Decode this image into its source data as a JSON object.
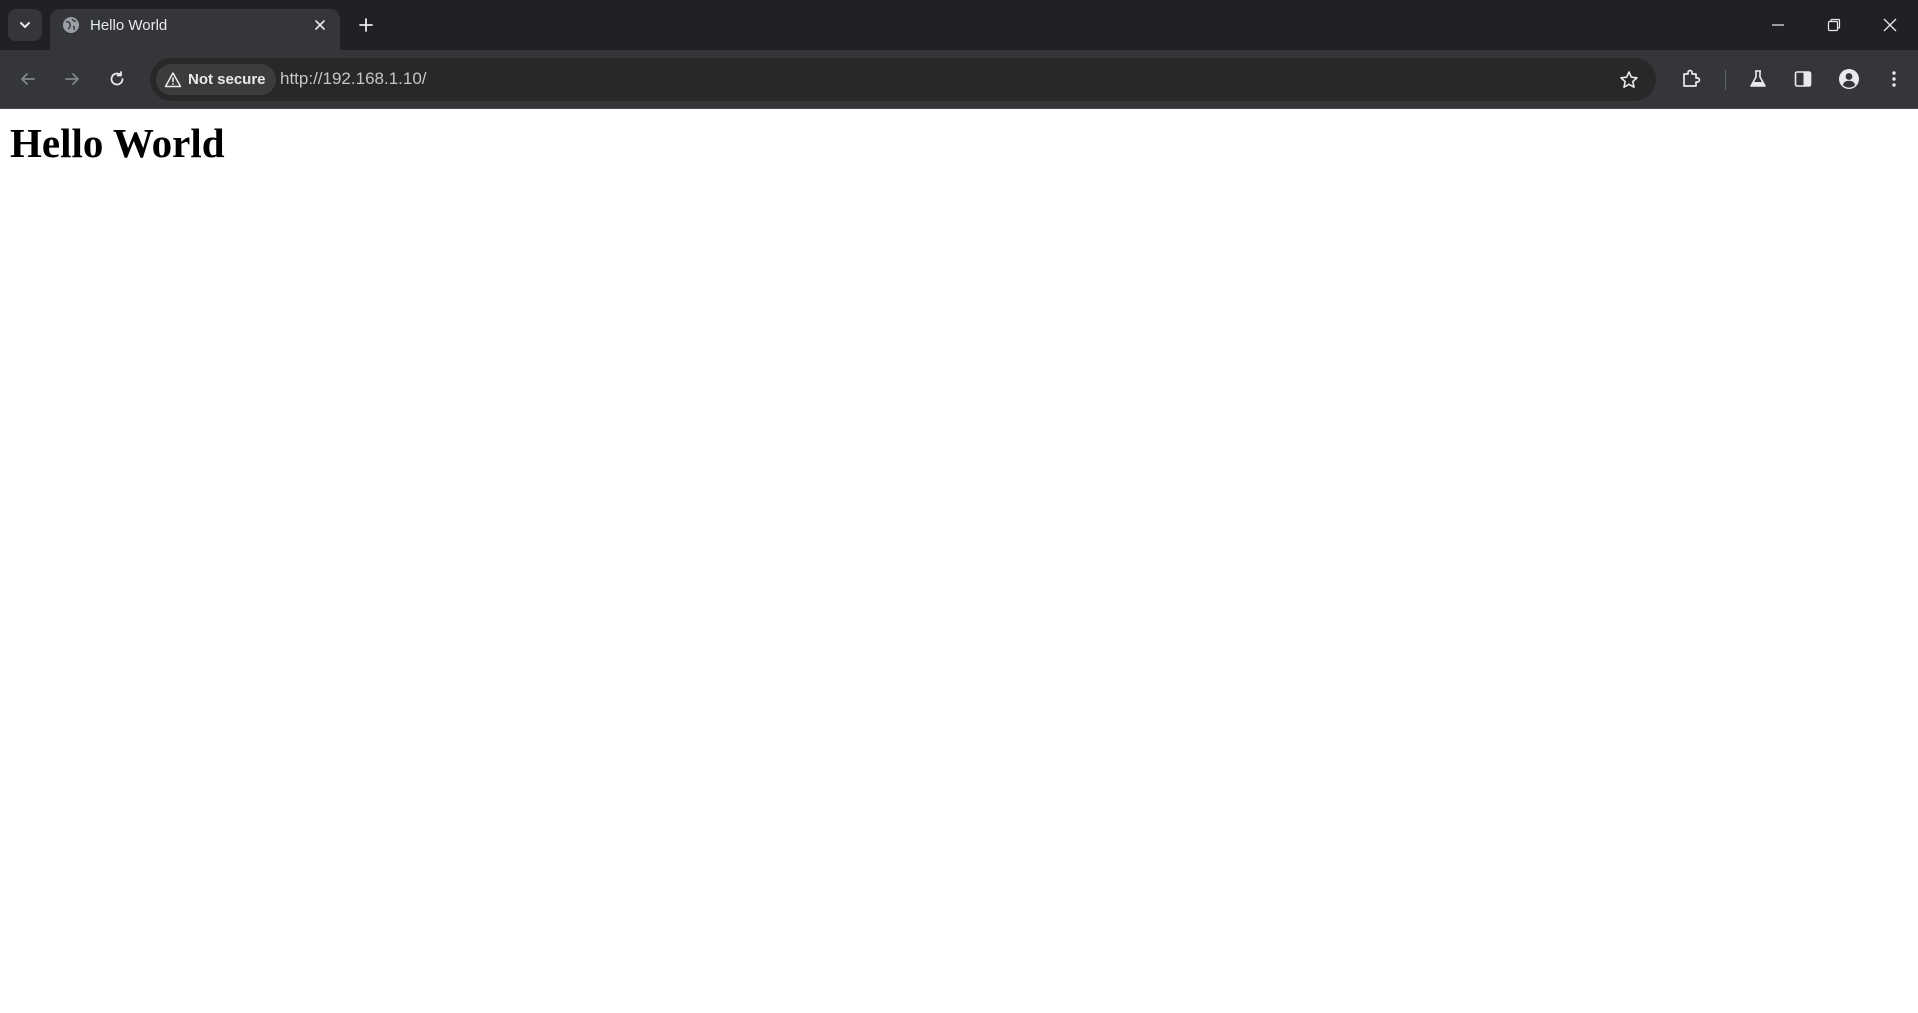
{
  "tab": {
    "title": "Hello World",
    "favicon": "globe-icon"
  },
  "omnibox": {
    "security_label": "Not secure",
    "url": "http://192.168.1.10/"
  },
  "page": {
    "heading": "Hello World"
  },
  "icons": {
    "tab_search": "chevron-down-icon",
    "tab_close": "close-icon",
    "new_tab": "plus-icon",
    "back": "arrow-left-icon",
    "forward": "arrow-right-icon",
    "reload": "reload-icon",
    "security": "warning-triangle-icon",
    "bookmark": "star-icon",
    "extensions": "puzzle-icon",
    "labs": "flask-icon",
    "side_panel": "side-panel-icon",
    "profile": "person-icon",
    "menu": "kebab-menu-icon",
    "minimize": "minimize-icon",
    "restore": "restore-icon",
    "close_window": "close-icon"
  },
  "colors": {
    "tabstrip_bg": "#202124",
    "toolbar_bg": "#35363a",
    "omnibox_bg": "#282828",
    "page_bg": "#ffffff"
  }
}
